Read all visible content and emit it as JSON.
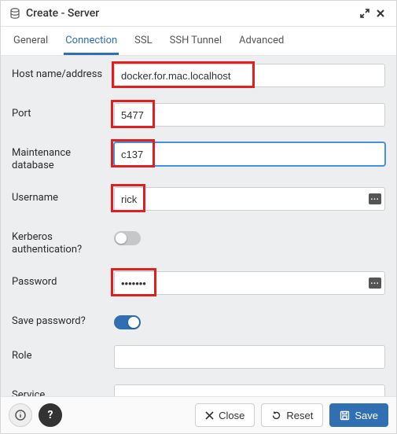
{
  "title": "Create - Server",
  "tabs": [
    "General",
    "Connection",
    "SSL",
    "SSH Tunnel",
    "Advanced"
  ],
  "active_tab_index": 1,
  "form": {
    "host": {
      "label": "Host name/address",
      "value": "docker.for.mac.localhost",
      "highlight": true
    },
    "port": {
      "label": "Port",
      "value": "5477",
      "highlight": true
    },
    "maint_db": {
      "label": "Maintenance database",
      "value": "c137",
      "highlight": true
    },
    "username": {
      "label": "Username",
      "value": "rick",
      "highlight": true
    },
    "kerberos": {
      "label": "Kerberos authentication?",
      "on": false
    },
    "password": {
      "label": "Password",
      "value": "•••••••",
      "highlight": true
    },
    "save_pw": {
      "label": "Save password?",
      "on": true
    },
    "role": {
      "label": "Role",
      "value": ""
    },
    "service": {
      "label": "Service",
      "value": ""
    }
  },
  "footer": {
    "close_label": "Close",
    "reset_label": "Reset",
    "save_label": "Save"
  }
}
